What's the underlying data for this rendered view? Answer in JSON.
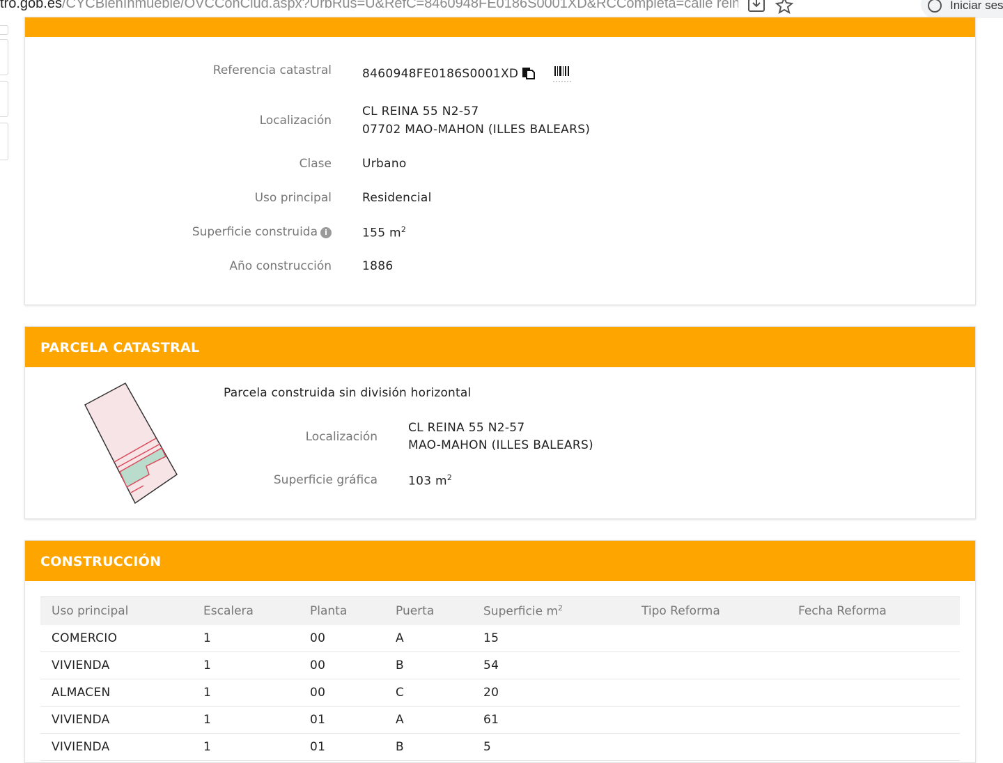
{
  "browser": {
    "url_host": "tro.gob.es",
    "url_path": "/CYCBienInmueble/OVCConCiud.aspx?UrbRus=U&RefC=8460948FE0186S0001XD&RCCompleta=calle reina&vi",
    "signin_label": "Iniciar ses"
  },
  "inmueble": {
    "referencia_label": "Referencia catastral",
    "referencia_value": "8460948FE0186S0001XD",
    "localizacion_label": "Localización",
    "localizacion_line1": "CL REINA 55 N2-57",
    "localizacion_line2": "07702 MAO-MAHON (ILLES BALEARS)",
    "clase_label": "Clase",
    "clase_value": "Urbano",
    "uso_label": "Uso principal",
    "uso_value": "Residencial",
    "superficie_label": "Superficie construida",
    "superficie_number": "155 m",
    "superficie_unit_sup": "2",
    "anio_label": "Año construcción",
    "anio_value": "1886"
  },
  "parcela": {
    "title": "PARCELA CATASTRAL",
    "descripcion": "Parcela construida sin división horizontal",
    "localizacion_label": "Localización",
    "localizacion_line1": "CL REINA 55 N2-57",
    "localizacion_line2": "MAO-MAHON (ILLES BALEARS)",
    "superficie_label": "Superficie gráfica",
    "superficie_number": "103 m",
    "superficie_unit_sup": "2"
  },
  "construccion": {
    "title": "CONSTRUCCIÓN",
    "columns": [
      "Uso principal",
      "Escalera",
      "Planta",
      "Puerta",
      "Superficie m",
      "Tipo Reforma",
      "Fecha Reforma"
    ],
    "superficie_col_sup": "2",
    "rows": [
      [
        "COMERCIO",
        "1",
        "00",
        "A",
        "15",
        "",
        ""
      ],
      [
        "VIVIENDA",
        "1",
        "00",
        "B",
        "54",
        "",
        ""
      ],
      [
        "ALMACEN",
        "1",
        "00",
        "C",
        "20",
        "",
        ""
      ],
      [
        "VIVIENDA",
        "1",
        "01",
        "A",
        "61",
        "",
        ""
      ],
      [
        "VIVIENDA",
        "1",
        "01",
        "B",
        "5",
        "",
        ""
      ]
    ]
  },
  "colors": {
    "header_orange": "#ffa500",
    "label_gray": "#777777",
    "parcel_fill": "#f7e4e6",
    "parcel_highlight": "#b9dccd",
    "parcel_line": "#d94a5a"
  },
  "icons": {
    "copy": "copy-icon",
    "barcode": "barcode-icon",
    "info": "info-icon",
    "download": "download-icon",
    "star": "star-icon",
    "account": "account-icon"
  }
}
